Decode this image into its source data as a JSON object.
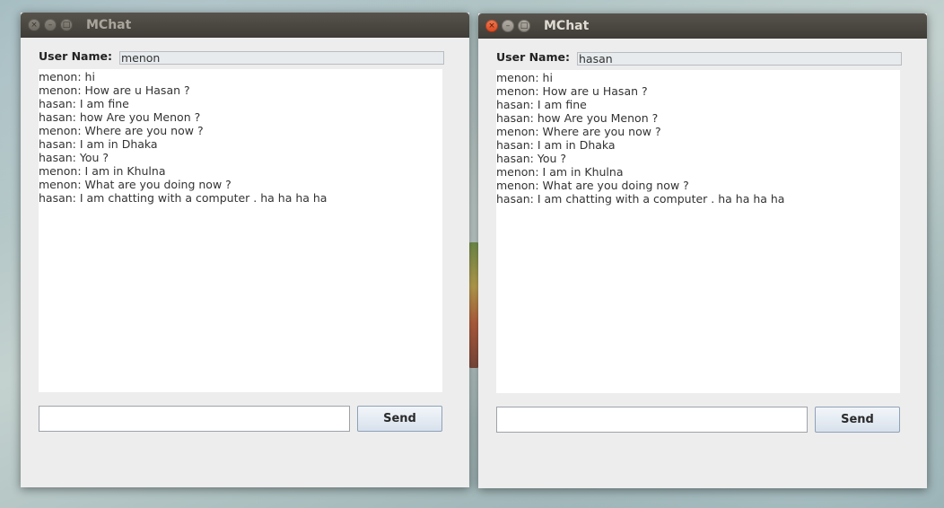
{
  "windows": [
    {
      "title": "MChat",
      "user_label": "User Name:",
      "user_name": "menon",
      "messages": [
        "menon: hi",
        "menon: How are u Hasan ?",
        "hasan: I am fine",
        "hasan: how Are you Menon ?",
        "menon: Where are you now ?",
        "hasan: I am in Dhaka",
        "hasan: You ?",
        "menon: I am in Khulna",
        "menon: What are you doing now ?",
        "hasan: I am chatting with a computer . ha ha ha ha"
      ],
      "message_input": "",
      "send_label": "Send",
      "buttons": {
        "close": "×",
        "minimize": "–",
        "maximize": "□"
      }
    },
    {
      "title": "MChat",
      "user_label": "User Name:",
      "user_name": "hasan",
      "messages": [
        "menon: hi",
        "menon: How are u Hasan ?",
        "hasan: I am fine",
        "hasan: how Are you Menon ?",
        "menon: Where are you now ?",
        "hasan: I am in Dhaka",
        "hasan: You ?",
        "menon: I am in Khulna",
        "menon: What are you doing now ?",
        "hasan: I am chatting with a computer . ha ha ha ha"
      ],
      "message_input": "",
      "send_label": "Send",
      "buttons": {
        "close": "×",
        "minimize": "–",
        "maximize": "□"
      }
    }
  ],
  "colors": {
    "titlebar": "#46433d",
    "window_bg": "#ededed",
    "close_active": "#e5562b",
    "send_button": "#dde5ef"
  }
}
